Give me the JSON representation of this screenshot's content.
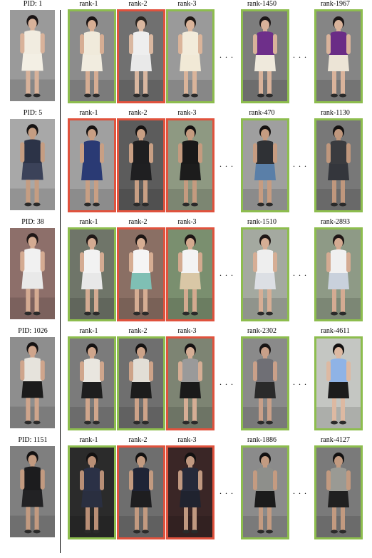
{
  "ellipsis": ". . .",
  "rows": [
    {
      "pid": "PID: 1",
      "query": {
        "bg": "#9a9a9a",
        "top": "#f1ece0",
        "bottom": "#f3efe4",
        "hair": "#1a1414",
        "skin": "#d8b29a"
      },
      "results": [
        {
          "label": "rank-1",
          "match": true,
          "bg": "#8c8c8c",
          "top": "#f0eadb",
          "bottom": "#f1ecdf",
          "hair": "#1a1414",
          "skin": "#d6ad93"
        },
        {
          "label": "rank-2",
          "match": false,
          "bg": "#707070",
          "top": "#eeeeee",
          "bottom": "#e9e9e9",
          "hair": "#2a2420",
          "skin": "#d9b7a0"
        },
        {
          "label": "rank-3",
          "match": true,
          "bg": "#9a9a9a",
          "top": "#f2ebda",
          "bottom": "#f1e9d6",
          "hair": "#201915",
          "skin": "#dab49a"
        },
        {
          "label": "rank-1450",
          "match": true,
          "bg": "#7d7d7d",
          "top": "#6e2f8a",
          "bottom": "#efe9dc",
          "hair": "#1c1717",
          "skin": "#d8b29a"
        },
        {
          "label": "rank-1967",
          "match": true,
          "bg": "#858585",
          "top": "#6a2c86",
          "bottom": "#ece4d6",
          "hair": "#1c1717",
          "skin": "#d9b39b"
        }
      ]
    },
    {
      "pid": "PID: 5",
      "query": {
        "bg": "#a8a8a8",
        "top": "#2c3347",
        "bottom": "#3b4259",
        "hair": "#151212",
        "skin": "#c59d82"
      },
      "results": [
        {
          "label": "rank-1",
          "match": false,
          "bg": "#a0a0a0",
          "top": "#2a3a74",
          "bottom": "#2a3a74",
          "hair": "#151212",
          "skin": "#c89f84"
        },
        {
          "label": "rank-2",
          "match": false,
          "bg": "#5c5c5c",
          "top": "#1e1e20",
          "bottom": "#1f1f21",
          "hair": "#141111",
          "skin": "#c89f84"
        },
        {
          "label": "rank-3",
          "match": false,
          "bg": "#8e9982",
          "top": "#191919",
          "bottom": "#1c1c1c",
          "hair": "#141111",
          "skin": "#c49b7f"
        },
        {
          "label": "rank-470",
          "match": true,
          "bg": "#9f9f9f",
          "top": "#2f3135",
          "bottom": "#5a7fa8",
          "hair": "#151212",
          "skin": "#c69c81"
        },
        {
          "label": "rank-1130",
          "match": true,
          "bg": "#787878",
          "top": "#3a3b3f",
          "bottom": "#34363c",
          "hair": "#151212",
          "skin": "#bf977d"
        }
      ]
    },
    {
      "pid": "PID: 38",
      "query": {
        "bg": "#8d6f6a",
        "top": "#f1f1f1",
        "bottom": "#e9e9e9",
        "hair": "#1f1716",
        "skin": "#d4ab92"
      },
      "results": [
        {
          "label": "rank-1",
          "match": true,
          "bg": "#6f7569",
          "top": "#f2f2f2",
          "bottom": "#e8e8e8",
          "hair": "#1f1716",
          "skin": "#d4ab92"
        },
        {
          "label": "rank-2",
          "match": false,
          "bg": "#8a6f64",
          "top": "#f5f5f5",
          "bottom": "#7fbfb4",
          "hair": "#1c1514",
          "skin": "#d6ad93"
        },
        {
          "label": "rank-3",
          "match": false,
          "bg": "#7a8f6f",
          "top": "#f3f3f3",
          "bottom": "#d9c7a6",
          "hair": "#1c1514",
          "skin": "#d3aa8f"
        },
        {
          "label": "rank-1510",
          "match": true,
          "bg": "#a4a9a0",
          "top": "#eeeeee",
          "bottom": "#dcdfe4",
          "hair": "#1f1716",
          "skin": "#d6ae95"
        },
        {
          "label": "rank-2893",
          "match": true,
          "bg": "#8e9a86",
          "top": "#f0f0f0",
          "bottom": "#c9d1dc",
          "hair": "#1f1716",
          "skin": "#d4ab92"
        }
      ]
    },
    {
      "pid": "PID: 1026",
      "query": {
        "bg": "#8e8e8e",
        "top": "#e6e3dc",
        "bottom": "#1b1b1b",
        "hair": "#141111",
        "skin": "#cfa58c"
      },
      "results": [
        {
          "label": "rank-1",
          "match": true,
          "bg": "#7b7b7b",
          "top": "#e9e6df",
          "bottom": "#1e1e1e",
          "hair": "#141111",
          "skin": "#d0a68c"
        },
        {
          "label": "rank-2",
          "match": true,
          "bg": "#6f6f6f",
          "top": "#e2ded6",
          "bottom": "#1c1c1c",
          "hair": "#141111",
          "skin": "#cda389"
        },
        {
          "label": "rank-3",
          "match": false,
          "bg": "#7d8473",
          "top": "#9a9a9a",
          "bottom": "#1a1a1a",
          "hair": "#141111",
          "skin": "#d5ae95"
        },
        {
          "label": "rank-2302",
          "match": true,
          "bg": "#8a8a8a",
          "top": "#6f6f75",
          "bottom": "#2a2a2a",
          "hair": "#181414",
          "skin": "#c9a089"
        },
        {
          "label": "rank-4611",
          "match": true,
          "bg": "#c4c6c2",
          "top": "#8fb3e6",
          "bottom": "#1c1c1c",
          "hair": "#121010",
          "skin": "#ddb9a2"
        }
      ]
    },
    {
      "pid": "PID: 1151",
      "query": {
        "bg": "#7f7f7f",
        "top": "#1c1c1e",
        "bottom": "#222224",
        "hair": "#121010",
        "skin": "#c29a80"
      },
      "results": [
        {
          "label": "rank-1",
          "match": true,
          "bg": "#2b2b2b",
          "top": "#2b3146",
          "bottom": "#2a2f40",
          "hair": "#121010",
          "skin": "#b98f76"
        },
        {
          "label": "rank-2",
          "match": false,
          "bg": "#6e6e6e",
          "top": "#1f2436",
          "bottom": "#1e1e20",
          "hair": "#121010",
          "skin": "#c29a80"
        },
        {
          "label": "rank-3",
          "match": false,
          "bg": "#3a2626",
          "top": "#262a3a",
          "bottom": "#20232f",
          "hair": "#121010",
          "skin": "#c09880"
        },
        {
          "label": "rank-1886",
          "match": true,
          "bg": "#8b8b8b",
          "top": "#8e8f8b",
          "bottom": "#1b1b1b",
          "hair": "#121010",
          "skin": "#c39b81"
        },
        {
          "label": "rank-4127",
          "match": true,
          "bg": "#7a7a7a",
          "top": "#9a9a94",
          "bottom": "#202020",
          "hair": "#121010",
          "skin": "#c29a80"
        }
      ]
    }
  ]
}
